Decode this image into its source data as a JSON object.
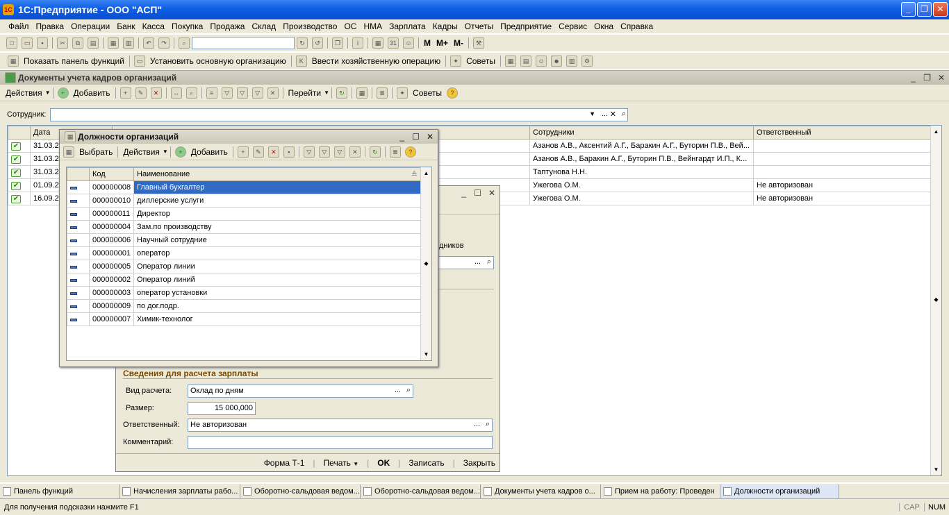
{
  "app": {
    "title": "1С:Предприятие - ООО \"АСП\""
  },
  "menu": [
    "Файл",
    "Правка",
    "Операции",
    "Банк",
    "Касса",
    "Покупка",
    "Продажа",
    "Склад",
    "Производство",
    "ОС",
    "НМА",
    "Зарплата",
    "Кадры",
    "Отчеты",
    "Предприятие",
    "Сервис",
    "Окна",
    "Справка"
  ],
  "toolbar2": {
    "show_panel": "Показать панель функций",
    "set_org": "Установить основную организацию",
    "enter_op": "Ввести хозяйственную операцию",
    "tips": "Советы"
  },
  "docwin": {
    "title": "Документы учета кадров организаций",
    "actions": "Действия",
    "add": "Добавить",
    "goto": "Перейти",
    "tips": "Советы",
    "employee_label": "Сотрудник:",
    "columns": [
      "Дата",
      "Сотрудники",
      "Ответственный"
    ],
    "rows": [
      {
        "date": "31.03.2",
        "emp": "Азанов А.В., Аксентий А.Г., Баракин А.Г., Буторин П.В., Вей...",
        "resp": ""
      },
      {
        "date": "31.03.2",
        "emp": "Азанов А.В., Баракин А.Г., Буторин П.В., Вейнгардт И.П., К...",
        "resp": ""
      },
      {
        "date": "31.03.2",
        "emp": "Таптунова Н.Н.",
        "resp": ""
      },
      {
        "date": "01.09.2",
        "emp": "Ужегова О.М.",
        "resp": "Не авторизован"
      },
      {
        "date": "16.09.2",
        "emp": "Ужегова О.М.",
        "resp": "Не авторизован"
      }
    ]
  },
  "hirewin": {
    "partial_text": "дников",
    "section": "Сведения для расчета зарплаты",
    "calc_type_label": "Вид расчета:",
    "calc_type": "Оклад по дням",
    "size_label": "Размер:",
    "size": "15 000,000",
    "resp_label": "Ответственный:",
    "resp": "Не авторизован",
    "comment_label": "Комментарий:",
    "comment": "",
    "buttons": {
      "form": "Форма Т-1",
      "print": "Печать",
      "ok": "OK",
      "save": "Записать",
      "close": "Закрыть"
    }
  },
  "poswin": {
    "title": "Должности организаций",
    "select": "Выбрать",
    "actions": "Действия",
    "add": "Добавить",
    "col_code": "Код",
    "col_name": "Наименование",
    "rows": [
      {
        "code": "000000008",
        "name": "Главный бухгалтер"
      },
      {
        "code": "000000010",
        "name": "диллерские услуги"
      },
      {
        "code": "000000011",
        "name": "Директор"
      },
      {
        "code": "000000004",
        "name": "Зам.по производству"
      },
      {
        "code": "000000006",
        "name": "Научный сотрудние"
      },
      {
        "code": "000000001",
        "name": "оператор"
      },
      {
        "code": "000000005",
        "name": "Оператор линии"
      },
      {
        "code": "000000002",
        "name": "Оператор линий"
      },
      {
        "code": "000000003",
        "name": "оператор установки"
      },
      {
        "code": "000000009",
        "name": "по дог.подр."
      },
      {
        "code": "000000007",
        "name": "Химик-технолог"
      }
    ]
  },
  "taskbar": [
    "Панель функций",
    "Начисления зарплаты рабо...",
    "Оборотно-сальдовая ведом...",
    "Оборотно-сальдовая ведом...",
    "Документы учета кадров о...",
    "Прием на работу: Проведен",
    "Должности организаций"
  ],
  "status": {
    "hint": "Для получения подсказки нажмите F1",
    "cap": "CAP",
    "num": "NUM"
  }
}
